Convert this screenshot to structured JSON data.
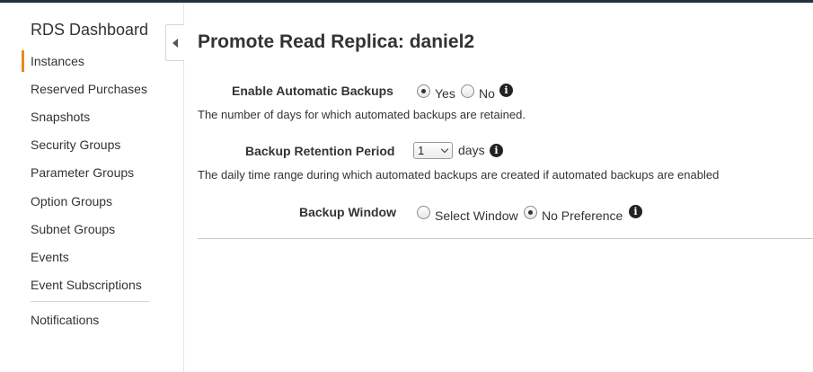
{
  "sidebar": {
    "title": "RDS Dashboard",
    "items": [
      {
        "label": "Instances",
        "active": true
      },
      {
        "label": "Reserved Purchases"
      },
      {
        "label": "Snapshots"
      },
      {
        "label": "Security Groups"
      },
      {
        "label": "Parameter Groups"
      },
      {
        "label": "Option Groups"
      },
      {
        "label": "Subnet Groups"
      },
      {
        "label": "Events"
      },
      {
        "label": "Event Subscriptions"
      },
      {
        "label": "Notifications"
      }
    ]
  },
  "page": {
    "title": "Promote Read Replica: daniel2"
  },
  "form": {
    "backups": {
      "label": "Enable Automatic Backups",
      "options": [
        "Yes",
        "No"
      ],
      "selected": "Yes",
      "help": "The number of days for which automated backups are retained."
    },
    "retention": {
      "label": "Backup Retention Period",
      "value": "1",
      "unit": "days",
      "help": "The daily time range during which automated backups are created if automated backups are enabled"
    },
    "window": {
      "label": "Backup Window",
      "options": [
        "Select Window",
        "No Preference"
      ],
      "selected": "No Preference"
    }
  },
  "icons": {
    "info": "info-icon",
    "collapse": "collapse-left-icon"
  },
  "colors": {
    "active_indicator": "#e88a1a",
    "top_bar": "#232f3e"
  }
}
